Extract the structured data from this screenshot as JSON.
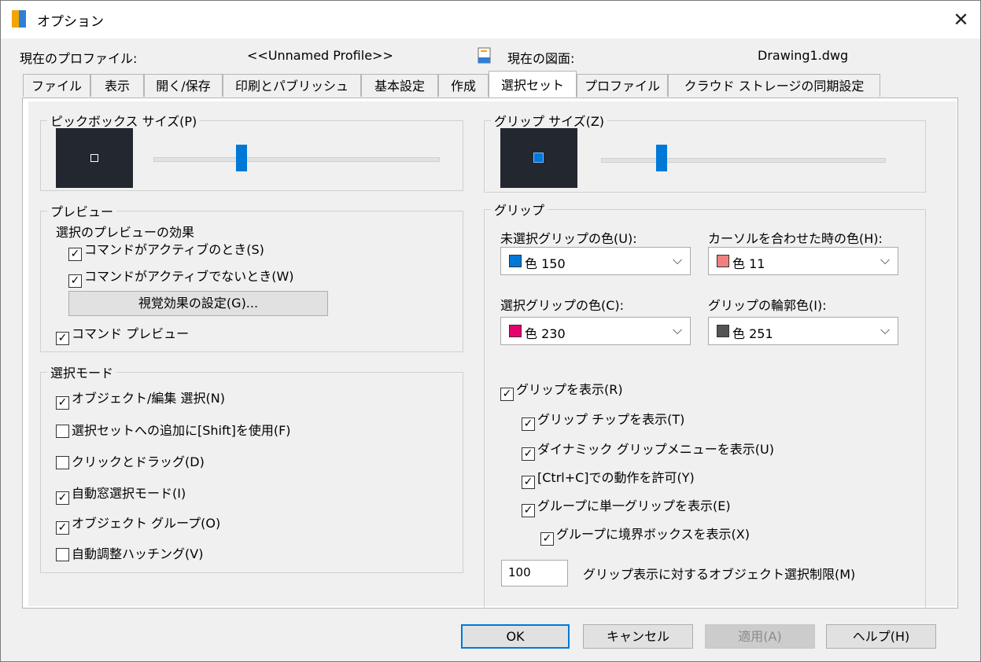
{
  "window": {
    "title": "オプション",
    "close_glyph": "✕"
  },
  "profile": {
    "label": "現在のプロファイル:",
    "value": "<<Unnamed Profile>>",
    "drawing_label": "現在の図面:",
    "drawing_value": "Drawing1.dwg"
  },
  "tabs": [
    {
      "label": "ファイル"
    },
    {
      "label": "表示"
    },
    {
      "label": "開く/保存"
    },
    {
      "label": "印刷とパブリッシュ"
    },
    {
      "label": "基本設定"
    },
    {
      "label": "作成"
    },
    {
      "label": "選択セット",
      "active": true
    },
    {
      "label": "プロファイル"
    },
    {
      "label": "クラウド ストレージの同期設定"
    }
  ],
  "pickbox": {
    "legend": "ピックボックス サイズ(P)",
    "slider_level": 0.3
  },
  "preview": {
    "legend": "プレビュー",
    "effect_label": "選択のプレビューの効果",
    "cb_active": {
      "label": "コマンドがアクティブのとき(S)",
      "checked": true
    },
    "cb_inactive": {
      "label": "コマンドがアクティブでないとき(W)",
      "checked": true
    },
    "visual_button": "視覚効果の設定(G)...",
    "cb_command": {
      "label": "コマンド プレビュー",
      "checked": true
    }
  },
  "selection_mode": {
    "legend": "選択モード",
    "items": [
      {
        "label": "オブジェクト/編集 選択(N)",
        "checked": true
      },
      {
        "label": "選択セットへの追加に[Shift]を使用(F)",
        "checked": false
      },
      {
        "label": "クリックとドラッグ(D)",
        "checked": false
      },
      {
        "label": "自動窓選択モード(I)",
        "checked": true
      },
      {
        "label": "オブジェクト グループ(O)",
        "checked": true
      },
      {
        "label": "自動調整ハッチング(V)",
        "checked": false
      }
    ]
  },
  "grip_size": {
    "legend": "グリップ サイズ(Z)",
    "slider_level": 0.2
  },
  "grips": {
    "legend": "グリップ",
    "unselected": {
      "label": "未選択グリップの色(U):",
      "value": "色 150",
      "color": "#0078d7"
    },
    "hover": {
      "label": "カーソルを合わせた時の色(H):",
      "value": "色 11",
      "color": "#f08080"
    },
    "selected": {
      "label": "選択グリップの色(C):",
      "value": "色 230",
      "color": "#e6006e"
    },
    "outline": {
      "label": "グリップの輪郭色(I):",
      "value": "色 251",
      "color": "#545454"
    },
    "show": {
      "label": "グリップを表示(R)",
      "checked": true
    },
    "tips": {
      "label": "グリップ チップを表示(T)",
      "checked": true
    },
    "dynamic": {
      "label": "ダイナミック グリップメニューを表示(U)",
      "checked": true
    },
    "ctrl": {
      "label": "[Ctrl+C]での動作を許可(Y)",
      "checked": true
    },
    "group_single": {
      "label": "グループに単一グリップを表示(E)",
      "checked": true
    },
    "group_box": {
      "label": "グループに境界ボックスを表示(X)",
      "checked": true
    },
    "limit_value": "100",
    "limit_label": "グリップ表示に対するオブジェクト選択制限(M)"
  },
  "buttons": {
    "ok": "OK",
    "cancel": "キャンセル",
    "apply": "適用(A)",
    "help": "ヘルプ(H)"
  },
  "check_glyph": "✓"
}
